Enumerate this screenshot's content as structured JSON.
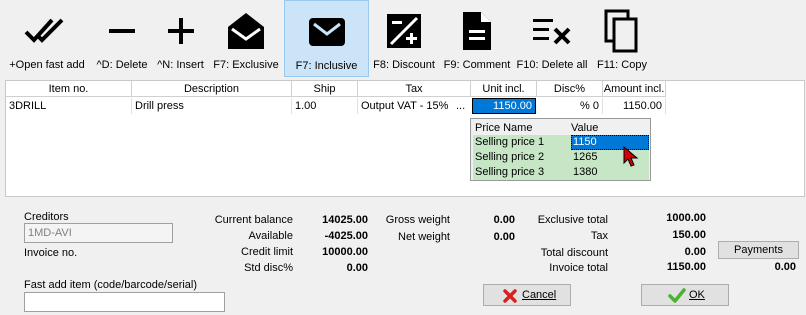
{
  "toolbar": {
    "buttons": [
      {
        "label": "+Open fast add",
        "icon": "double-check-icon"
      },
      {
        "label": "^D: Delete",
        "icon": "minus-icon"
      },
      {
        "label": "^N: Insert",
        "icon": "plus-icon"
      },
      {
        "label": "F7: Exclusive",
        "icon": "open-envelope-icon"
      },
      {
        "label": "F7: Inclusive",
        "icon": "envelope-icon",
        "active": true
      },
      {
        "label": "F8: Discount",
        "icon": "discount-icon"
      },
      {
        "label": "F9: Comment",
        "icon": "document-icon"
      },
      {
        "label": "F10: Delete all",
        "icon": "delete-all-icon"
      },
      {
        "label": "F11: Copy",
        "icon": "copy-icon"
      }
    ]
  },
  "grid": {
    "headers": [
      "Item no.",
      "Description",
      "Ship",
      "Tax",
      "Unit incl.",
      "Disc%",
      "Amount incl."
    ],
    "row": {
      "item_no": "3DRILL",
      "description": "Drill press",
      "ship": "1.00",
      "tax": "Output VAT - 15%",
      "tax_ellipsis": "...",
      "unit_incl": "1150.00",
      "disc": "% 0",
      "amount_incl": "1150.00"
    }
  },
  "price_popup": {
    "headers": [
      "Price Name",
      "Value"
    ],
    "rows": [
      {
        "name": "Selling price 1",
        "value": "1150"
      },
      {
        "name": "Selling price 2",
        "value": "1265"
      },
      {
        "name": "Selling price 3",
        "value": "1380"
      }
    ]
  },
  "creditors": {
    "label": "Creditors",
    "value": "1MD-AVI"
  },
  "invoice_no_label": "Invoice no.",
  "balances": {
    "current_balance_label": "Current balance",
    "current_balance": "14025.00",
    "available_label": "Available",
    "available": "-4025.00",
    "credit_limit_label": "Credit limit",
    "credit_limit": "10000.00",
    "std_disc_label": "Std disc%",
    "std_disc": "0.00"
  },
  "weights": {
    "gross_label": "Gross weight",
    "gross": "0.00",
    "net_label": "Net weight",
    "net": "0.00"
  },
  "totals": {
    "exclusive_label": "Exclusive total",
    "exclusive": "1000.00",
    "tax_label": "Tax",
    "tax": "150.00",
    "discount_label": "Total discount",
    "discount": "0.00",
    "invoice_label": "Invoice total",
    "invoice": "1150.00"
  },
  "payments": {
    "label": "Payments",
    "value": "0.00"
  },
  "fast_add": {
    "label": "Fast add item (code/barcode/serial)",
    "value": ""
  },
  "buttons": {
    "cancel": "Cancel",
    "ok": "OK"
  },
  "colors": {
    "selected": "#0078d7",
    "popup_row": "#c6e6c6",
    "active_tool": "#cce4f7"
  }
}
